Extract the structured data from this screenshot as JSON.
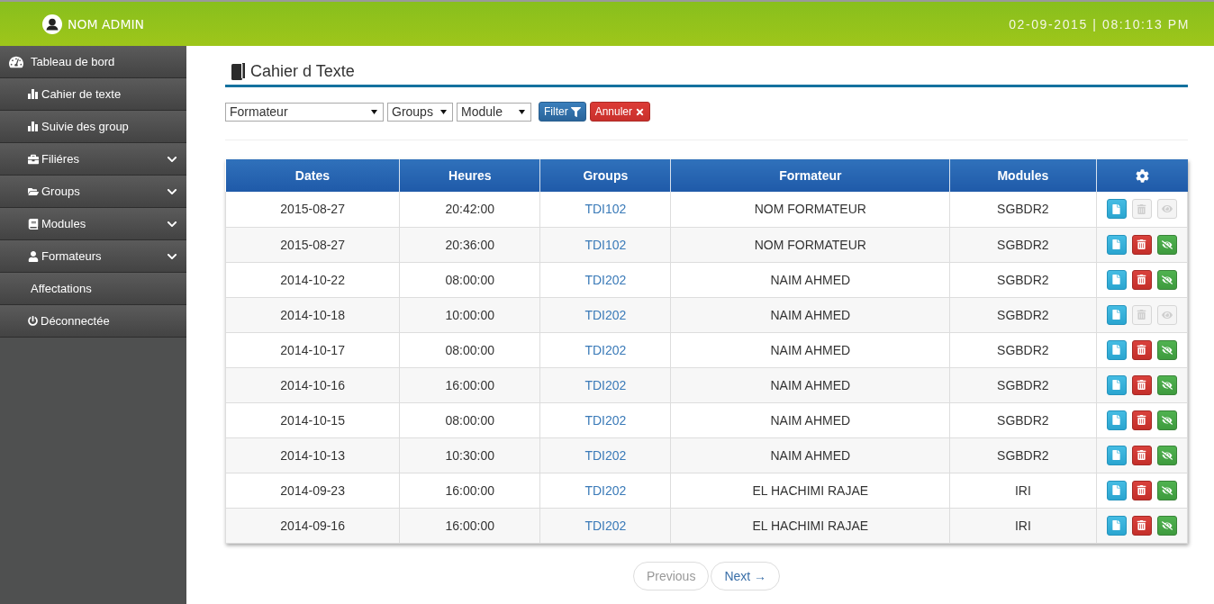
{
  "header": {
    "user_name": "NOM ADMIN",
    "datetime": "02-09-2015 | 08:10:13 PM"
  },
  "sidebar": {
    "items": [
      {
        "label": "Tableau de bord"
      },
      {
        "label": "Cahier de texte"
      },
      {
        "label": "Suivie des group"
      },
      {
        "label": "Filiéres",
        "expanded": false
      },
      {
        "label": "Groups",
        "expanded": false
      },
      {
        "label": "Modules",
        "expanded": false
      },
      {
        "label": "Formateurs",
        "expanded": false
      },
      {
        "label": "Affectations"
      },
      {
        "label": "Déconnectée"
      }
    ]
  },
  "page": {
    "title": "Cahier d Texte"
  },
  "filters": {
    "selects": [
      {
        "value": "Formateur"
      },
      {
        "value": "Groups"
      },
      {
        "value": "Module"
      }
    ],
    "buttons": [
      {
        "kind": "filter",
        "label": "Filter"
      },
      {
        "kind": "cancel",
        "label": "Annuler"
      }
    ]
  },
  "table": {
    "columns": [
      {
        "kind": "text",
        "label": "Dates"
      },
      {
        "kind": "text",
        "label": "Heures"
      },
      {
        "kind": "text",
        "label": "Groups"
      },
      {
        "kind": "text",
        "label": "Formateur"
      },
      {
        "kind": "text",
        "label": "Modules"
      },
      {
        "kind": "actions"
      }
    ],
    "rows": [
      {
        "date": "2015-08-27",
        "time": "20:42:00",
        "group": "TDI102",
        "formateur": "NOM FORMATEUR",
        "module": "SGBDR2",
        "actions": [
          {
            "kind": "edit",
            "disabled": false
          },
          {
            "kind": "delete",
            "disabled": true
          },
          {
            "kind": "view",
            "disabled": true
          }
        ]
      },
      {
        "date": "2015-08-27",
        "time": "20:36:00",
        "group": "TDI102",
        "formateur": "NOM FORMATEUR",
        "module": "SGBDR2",
        "actions": [
          {
            "kind": "edit",
            "disabled": false
          },
          {
            "kind": "delete",
            "disabled": false
          },
          {
            "kind": "view",
            "disabled": false
          }
        ]
      },
      {
        "date": "2014-10-22",
        "time": "08:00:00",
        "group": "TDI202",
        "formateur": "NAIM AHMED",
        "module": "SGBDR2",
        "actions": [
          {
            "kind": "edit",
            "disabled": false
          },
          {
            "kind": "delete",
            "disabled": false
          },
          {
            "kind": "view",
            "disabled": false
          }
        ]
      },
      {
        "date": "2014-10-18",
        "time": "10:00:00",
        "group": "TDI202",
        "formateur": "NAIM AHMED",
        "module": "SGBDR2",
        "actions": [
          {
            "kind": "edit",
            "disabled": false
          },
          {
            "kind": "delete",
            "disabled": true
          },
          {
            "kind": "view",
            "disabled": true
          }
        ]
      },
      {
        "date": "2014-10-17",
        "time": "08:00:00",
        "group": "TDI202",
        "formateur": "NAIM AHMED",
        "module": "SGBDR2",
        "actions": [
          {
            "kind": "edit",
            "disabled": false
          },
          {
            "kind": "delete",
            "disabled": false
          },
          {
            "kind": "view",
            "disabled": false
          }
        ]
      },
      {
        "date": "2014-10-16",
        "time": "16:00:00",
        "group": "TDI202",
        "formateur": "NAIM AHMED",
        "module": "SGBDR2",
        "actions": [
          {
            "kind": "edit",
            "disabled": false
          },
          {
            "kind": "delete",
            "disabled": false
          },
          {
            "kind": "view",
            "disabled": false
          }
        ]
      },
      {
        "date": "2014-10-15",
        "time": "08:00:00",
        "group": "TDI202",
        "formateur": "NAIM AHMED",
        "module": "SGBDR2",
        "actions": [
          {
            "kind": "edit",
            "disabled": false
          },
          {
            "kind": "delete",
            "disabled": false
          },
          {
            "kind": "view",
            "disabled": false
          }
        ]
      },
      {
        "date": "2014-10-13",
        "time": "10:30:00",
        "group": "TDI202",
        "formateur": "NAIM AHMED",
        "module": "SGBDR2",
        "actions": [
          {
            "kind": "edit",
            "disabled": false
          },
          {
            "kind": "delete",
            "disabled": false
          },
          {
            "kind": "view",
            "disabled": false
          }
        ]
      },
      {
        "date": "2014-09-23",
        "time": "16:00:00",
        "group": "TDI202",
        "formateur": "EL HACHIMI RAJAE",
        "module": "IRI",
        "actions": [
          {
            "kind": "edit",
            "disabled": false
          },
          {
            "kind": "delete",
            "disabled": false
          },
          {
            "kind": "view",
            "disabled": false
          }
        ]
      },
      {
        "date": "2014-09-16",
        "time": "16:00:00",
        "group": "TDI202",
        "formateur": "EL HACHIMI RAJAE",
        "module": "IRI",
        "actions": [
          {
            "kind": "edit",
            "disabled": false
          },
          {
            "kind": "delete",
            "disabled": false
          },
          {
            "kind": "view",
            "disabled": false
          }
        ]
      }
    ]
  },
  "pagination": {
    "previous": {
      "label": "Previous",
      "disabled": true
    },
    "next": {
      "label": "Next →",
      "disabled": false
    }
  }
}
